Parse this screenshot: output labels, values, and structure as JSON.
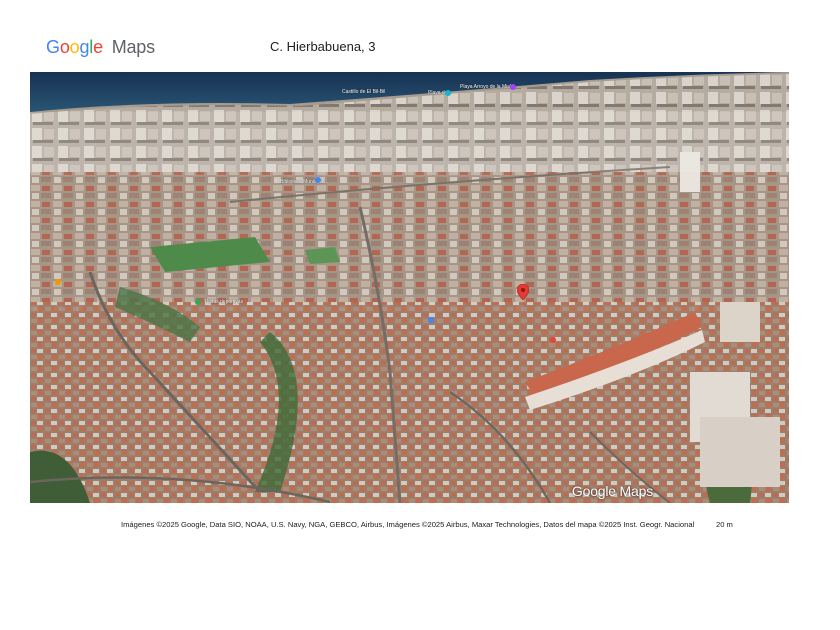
{
  "header": {
    "logo_google": "Google",
    "logo_maps": "Maps",
    "address": "C. Hierbabuena, 3"
  },
  "map": {
    "view": "satellite-3d",
    "marker_icon": "red-location-pin-icon",
    "watermark": "Google Maps",
    "pois": [
      {
        "label": "Castillo de El Bil-Bil"
      },
      {
        "label": "Playa de..."
      },
      {
        "label": "Playa Arroyo de la Miel"
      },
      {
        "label": "Biblioteca Municipal..."
      },
      {
        "label": "Pistas deportivas"
      }
    ]
  },
  "footer": {
    "attribution": "Imágenes ©2025 Google, Data SIO, NOAA, U.S. Navy, NGA, GEBCO, Airbus, Imágenes ©2025 Airbus, Maxar Technologies, Datos del mapa ©2025 Inst. Geogr. Nacional",
    "scale": "20 m"
  },
  "colors": {
    "google_blue": "#4285F4",
    "google_red": "#EA4335",
    "google_yellow": "#FBBC05",
    "google_green": "#34A853",
    "sea": "#1e3a5a",
    "marker": "#e53935"
  }
}
